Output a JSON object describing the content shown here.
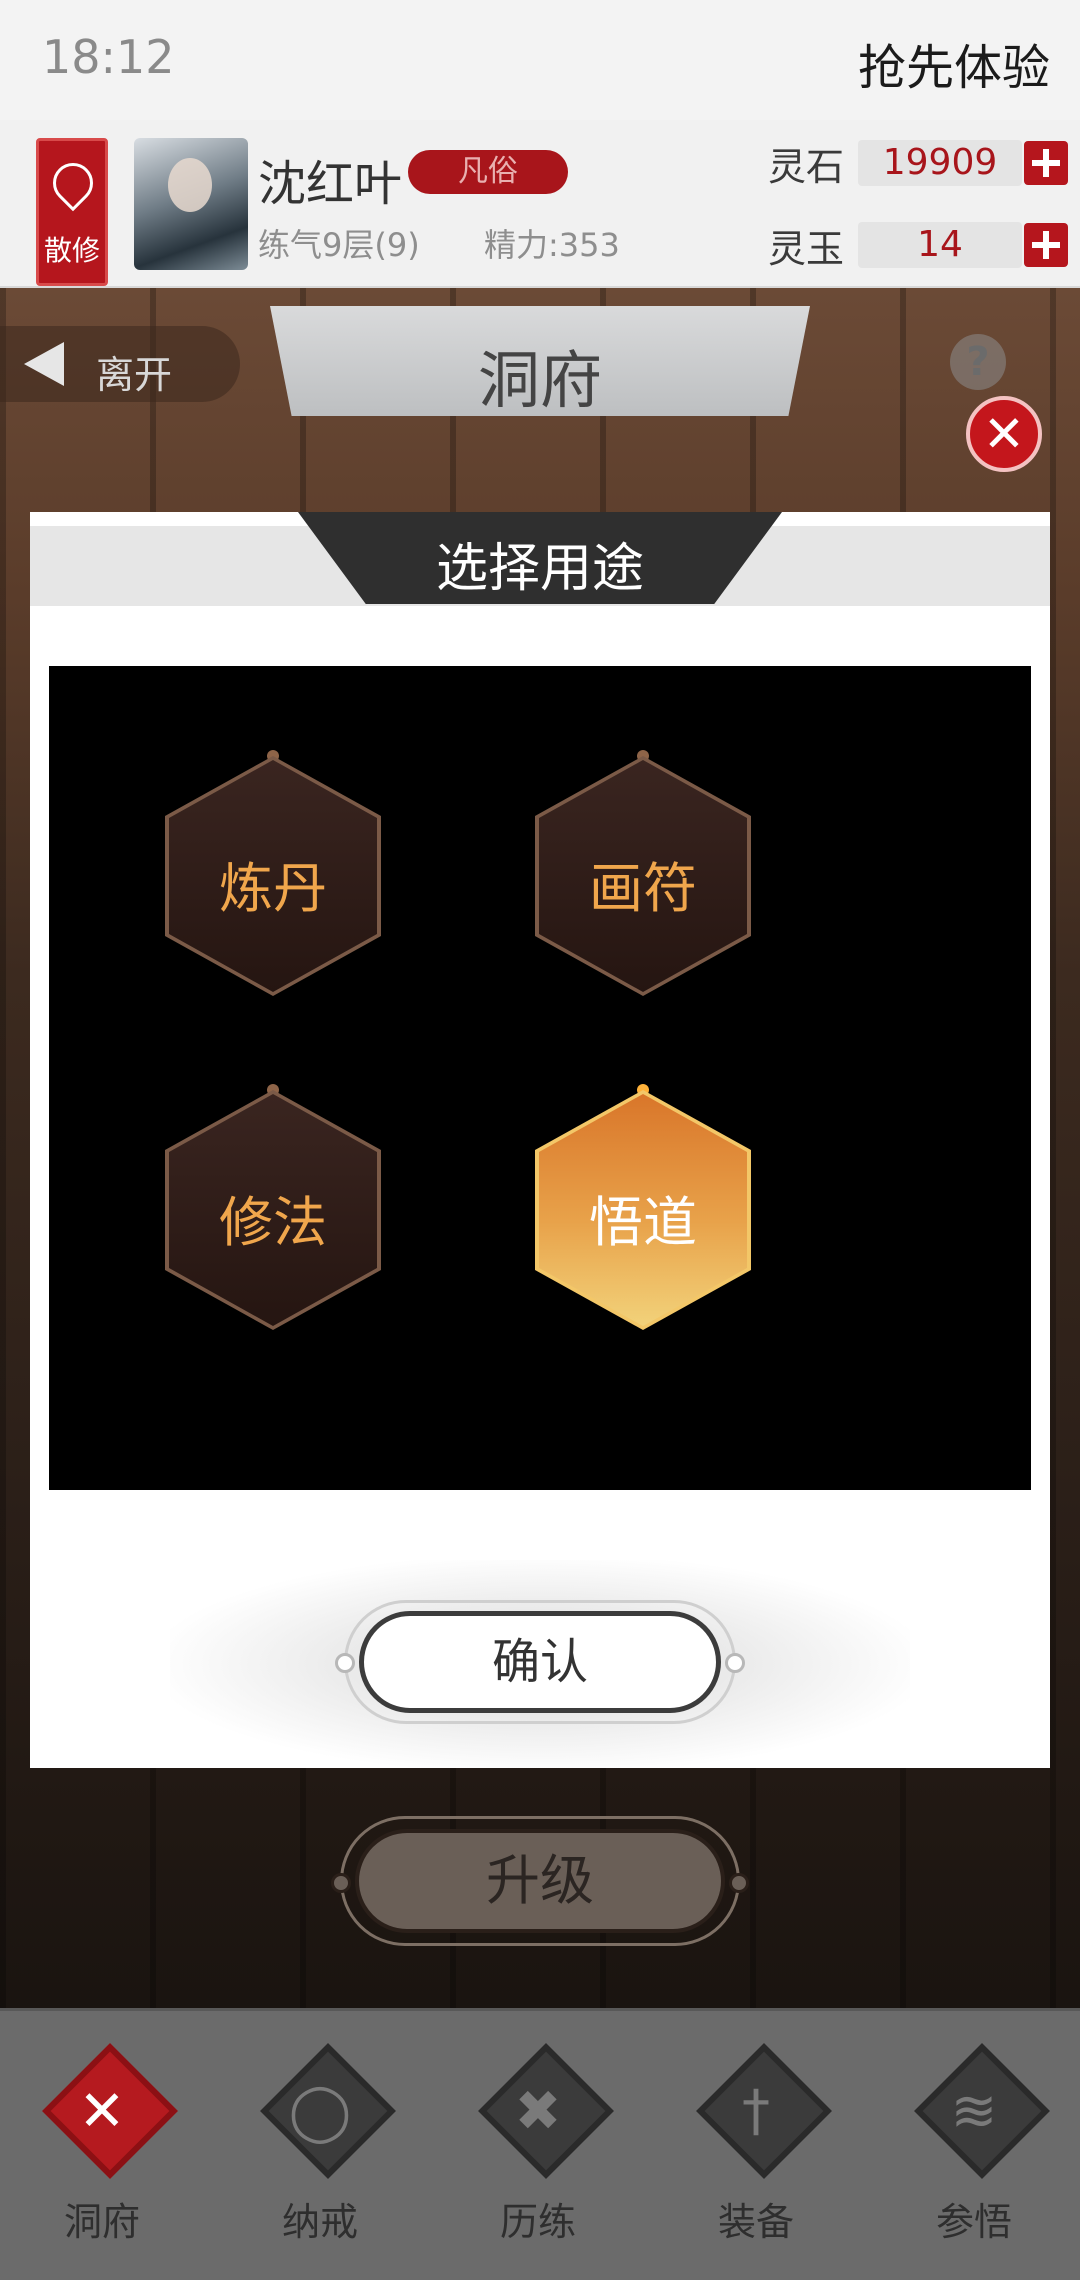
{
  "status": {
    "time": "18:12",
    "early_access": "抢先体验"
  },
  "player": {
    "sect": "散修",
    "name": "沈红叶",
    "rank": "凡俗",
    "realm": "练气9层(9)",
    "energy": "精力:353"
  },
  "currency": [
    {
      "label": "灵石",
      "value": "19909"
    },
    {
      "label": "灵玉",
      "value": "14"
    }
  ],
  "nav": {
    "leave": "离开",
    "title": "洞府",
    "help": "?"
  },
  "modal": {
    "title": "选择用途",
    "options": [
      {
        "label": "炼丹",
        "selected": false
      },
      {
        "label": "画符",
        "selected": false
      },
      {
        "label": "修法",
        "selected": false
      },
      {
        "label": "悟道",
        "selected": true
      }
    ],
    "confirm": "确认",
    "close": "✕"
  },
  "upgrade": "升级",
  "tabs": [
    {
      "label": "洞府",
      "icon": "cave-icon",
      "glyph": "✕",
      "active": true
    },
    {
      "label": "纳戒",
      "icon": "ring-icon",
      "glyph": "◯",
      "active": false
    },
    {
      "label": "历练",
      "icon": "crossed-swords-icon",
      "glyph": "✖",
      "active": false
    },
    {
      "label": "装备",
      "icon": "sword-icon",
      "glyph": "†",
      "active": false
    },
    {
      "label": "参悟",
      "icon": "book-icon",
      "glyph": "≋",
      "active": false
    }
  ],
  "colors": {
    "accent_red": "#b5161d",
    "selected_gold": "#e8a24a",
    "option_text": "#f0a64c"
  }
}
